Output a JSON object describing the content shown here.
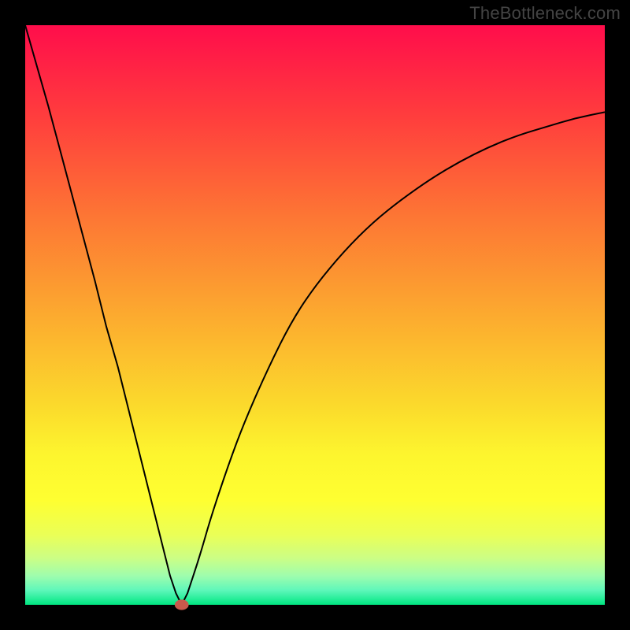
{
  "watermark": "TheBottleneck.com",
  "chart_data": {
    "type": "line",
    "title": "",
    "xlabel": "",
    "ylabel": "",
    "xlim": [
      0,
      100
    ],
    "ylim": [
      0,
      100
    ],
    "grid": false,
    "legend": false,
    "background_gradient": {
      "direction": "vertical",
      "stops": [
        {
          "offset": 0.0,
          "color": "#ff0d4b"
        },
        {
          "offset": 0.16,
          "color": "#ff3e3d"
        },
        {
          "offset": 0.33,
          "color": "#fd7634"
        },
        {
          "offset": 0.5,
          "color": "#fcaa2f"
        },
        {
          "offset": 0.66,
          "color": "#fbdb2c"
        },
        {
          "offset": 0.74,
          "color": "#fdf52e"
        },
        {
          "offset": 0.82,
          "color": "#feff31"
        },
        {
          "offset": 0.88,
          "color": "#eaff57"
        },
        {
          "offset": 0.92,
          "color": "#cbfe86"
        },
        {
          "offset": 0.95,
          "color": "#9ffdad"
        },
        {
          "offset": 0.975,
          "color": "#5ef7ba"
        },
        {
          "offset": 1.0,
          "color": "#00e681"
        }
      ]
    },
    "series": [
      {
        "name": "bottleneck-curve",
        "type": "line",
        "stroke": "#000000",
        "stroke_width": 2,
        "x": [
          0,
          2,
          4,
          6,
          8,
          10,
          12,
          14,
          16,
          18,
          20,
          22,
          24,
          25,
          26,
          27,
          28,
          30,
          32,
          35,
          38,
          42,
          46,
          50,
          55,
          60,
          65,
          70,
          75,
          80,
          85,
          90,
          95,
          100
        ],
        "y": [
          100,
          93,
          86,
          78.5,
          71,
          63.5,
          56,
          48,
          41,
          33,
          25,
          17,
          9,
          5,
          2,
          0,
          2,
          8,
          15,
          24,
          32,
          41,
          49,
          55,
          61,
          66,
          70,
          73.5,
          76.5,
          79,
          81,
          82.5,
          84,
          85
        ]
      }
    ],
    "markers": [
      {
        "name": "optimal-point",
        "shape": "ellipse",
        "cx": 27,
        "cy": 0,
        "rx": 1.2,
        "ry": 0.9,
        "fill": "#c9594c"
      }
    ]
  }
}
